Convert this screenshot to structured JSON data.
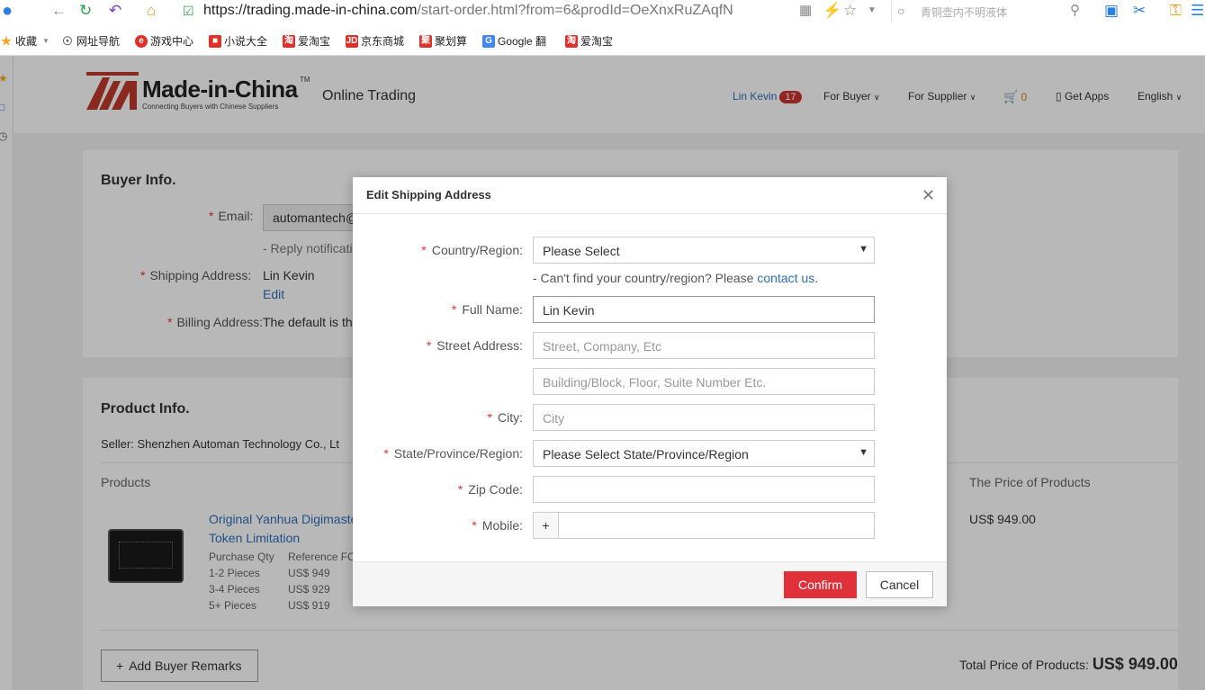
{
  "browser": {
    "url_host": "https://trading.made-in-china.com",
    "url_rest": "/start-order.html?from=6&prodId=OeXnxRuZAqfN",
    "search_placeholder": "青铜壶内不明液体",
    "bookmarks": [
      {
        "label": "收藏",
        "icon": "star-icon",
        "color": "#f5a623"
      },
      {
        "label": "网址导航",
        "icon": "globe-icon",
        "color": "#666666"
      },
      {
        "label": "游戏中心",
        "icon": "game-icon",
        "color": "#e0302a"
      },
      {
        "label": "小说大全",
        "icon": "book-icon",
        "color": "#e0302a"
      },
      {
        "label": "爱淘宝",
        "icon": "taobao-icon",
        "color": "#e0302a"
      },
      {
        "label": "京东商城",
        "icon": "jd-icon",
        "color": "#e0302a"
      },
      {
        "label": "聚划算",
        "icon": "juhuasuan-icon",
        "color": "#e0302a"
      },
      {
        "label": "Google 翻",
        "icon": "google-translate-icon",
        "color": "#4285f4"
      },
      {
        "label": "爱淘宝",
        "icon": "taobao-icon",
        "color": "#e0302a"
      }
    ]
  },
  "header": {
    "logo_text": "Made-in-China",
    "logo_tm": "TM",
    "logo_tagline": "Connecting Buyers with Chinese Suppliers",
    "section": "Online Trading",
    "user": "Lin Kevin",
    "badge": "17",
    "for_buyer": "For Buyer",
    "for_supplier": "For Supplier",
    "cart_count": "0",
    "get_apps": "Get Apps",
    "language": "English",
    "accent": "#c0392b"
  },
  "buyer": {
    "title": "Buyer Info.",
    "email_label": "Email:",
    "email_value": "automantech@",
    "reply_note": "- Reply notificati",
    "shipping_label": "Shipping Address:",
    "shipping_name": "Lin Kevin",
    "edit": "Edit",
    "billing_label": "Billing Address:",
    "billing_value": "The default is th"
  },
  "product": {
    "title": "Product Info.",
    "seller": "Seller: Shenzhen Automan Technology Co., Lt",
    "col_products": "Products",
    "col_price": "The Price of Products",
    "name_line1": "Original Yanhua Digimaste",
    "name_line2": "Token Limitation",
    "qty_header": "Purchase Qty",
    "ref_header": "Reference FO",
    "tiers": [
      {
        "qty": "1-2 Pieces",
        "price": "US$ 949"
      },
      {
        "qty": "3-4 Pieces",
        "price": "US$ 929"
      },
      {
        "qty": "5+ Pieces",
        "price": "US$ 919"
      }
    ],
    "price": "US$ 949.00",
    "add_remarks": "Add Buyer Remarks",
    "total_label": "Total Price of Products:",
    "total_value": "US$ 949.00"
  },
  "modal": {
    "title": "Edit Shipping Address",
    "country_label": "Country/Region:",
    "country_value": "Please Select",
    "hint_text": "- Can't find your country/region? Please ",
    "hint_link": "contact us",
    "hint_end": ".",
    "fullname_label": "Full Name:",
    "fullname_value": "Lin Kevin",
    "street_label": "Street Address:",
    "street_placeholder": "Street, Company, Etc",
    "street2_placeholder": "Building/Block, Floor, Suite Number Etc.",
    "city_label": "City:",
    "city_placeholder": "City",
    "state_label": "State/Province/Region:",
    "state_value": "Please Select State/Province/Region",
    "zip_label": "Zip Code:",
    "zip_value": "",
    "mobile_label": "Mobile:",
    "mobile_prefix": "+",
    "mobile_value": "",
    "confirm": "Confirm",
    "cancel": "Cancel",
    "confirm_color": "#e0303a"
  }
}
